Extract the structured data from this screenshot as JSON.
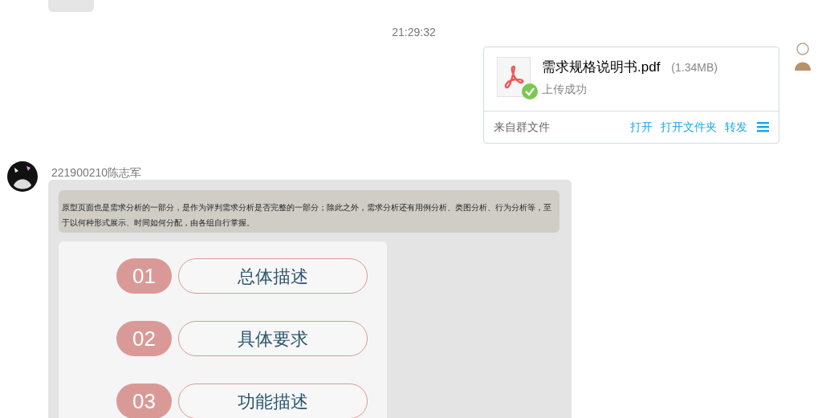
{
  "timestamp": "21:29:32",
  "file_message": {
    "file_name": "需求规格说明书.pdf",
    "size": "(1.34MB)",
    "status": "上传成功",
    "uploaded": true,
    "source": "来自群文件",
    "actions": [
      "打开",
      "打开文件夹",
      "转发"
    ]
  },
  "image_message": {
    "sender": "221900210陈志军",
    "note": "原型页面也是需求分析的一部分，是作为评判需求分析是否完整的一部分；除此之外，需求分析还有用例分析、类图分析、行为分析等，至于以何种形式展示、时间如何分配，由各组自行掌握。",
    "items": [
      {
        "number": "01",
        "label": "总体描述"
      },
      {
        "number": "02",
        "label": "具体要求"
      },
      {
        "number": "03",
        "label": "功能描述"
      }
    ]
  }
}
